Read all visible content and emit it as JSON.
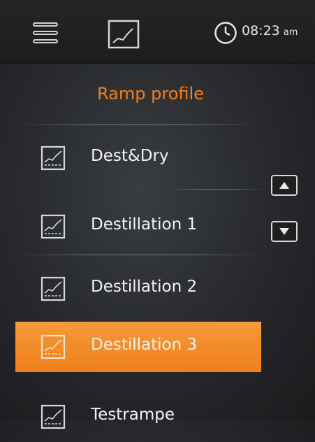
{
  "header": {
    "time": "08:23",
    "time_suffix": "am"
  },
  "panel": {
    "title": "Ramp profile"
  },
  "profiles": [
    {
      "label": "Dest&Dry",
      "selected": false
    },
    {
      "label": "Destillation 1",
      "selected": false
    },
    {
      "label": "Destillation 2",
      "selected": false
    },
    {
      "label": "Destillation 3",
      "selected": true
    },
    {
      "label": "Testrampe",
      "selected": false
    }
  ],
  "icons": {
    "menu": "menu-icon",
    "chart": "chart-icon",
    "clock": "clock-icon",
    "profile": "ramp-profile-icon",
    "up": "arrow-up-icon",
    "down": "arrow-down-icon"
  },
  "colors": {
    "accent": "#f07f1e",
    "background": "#2a2c2e"
  }
}
